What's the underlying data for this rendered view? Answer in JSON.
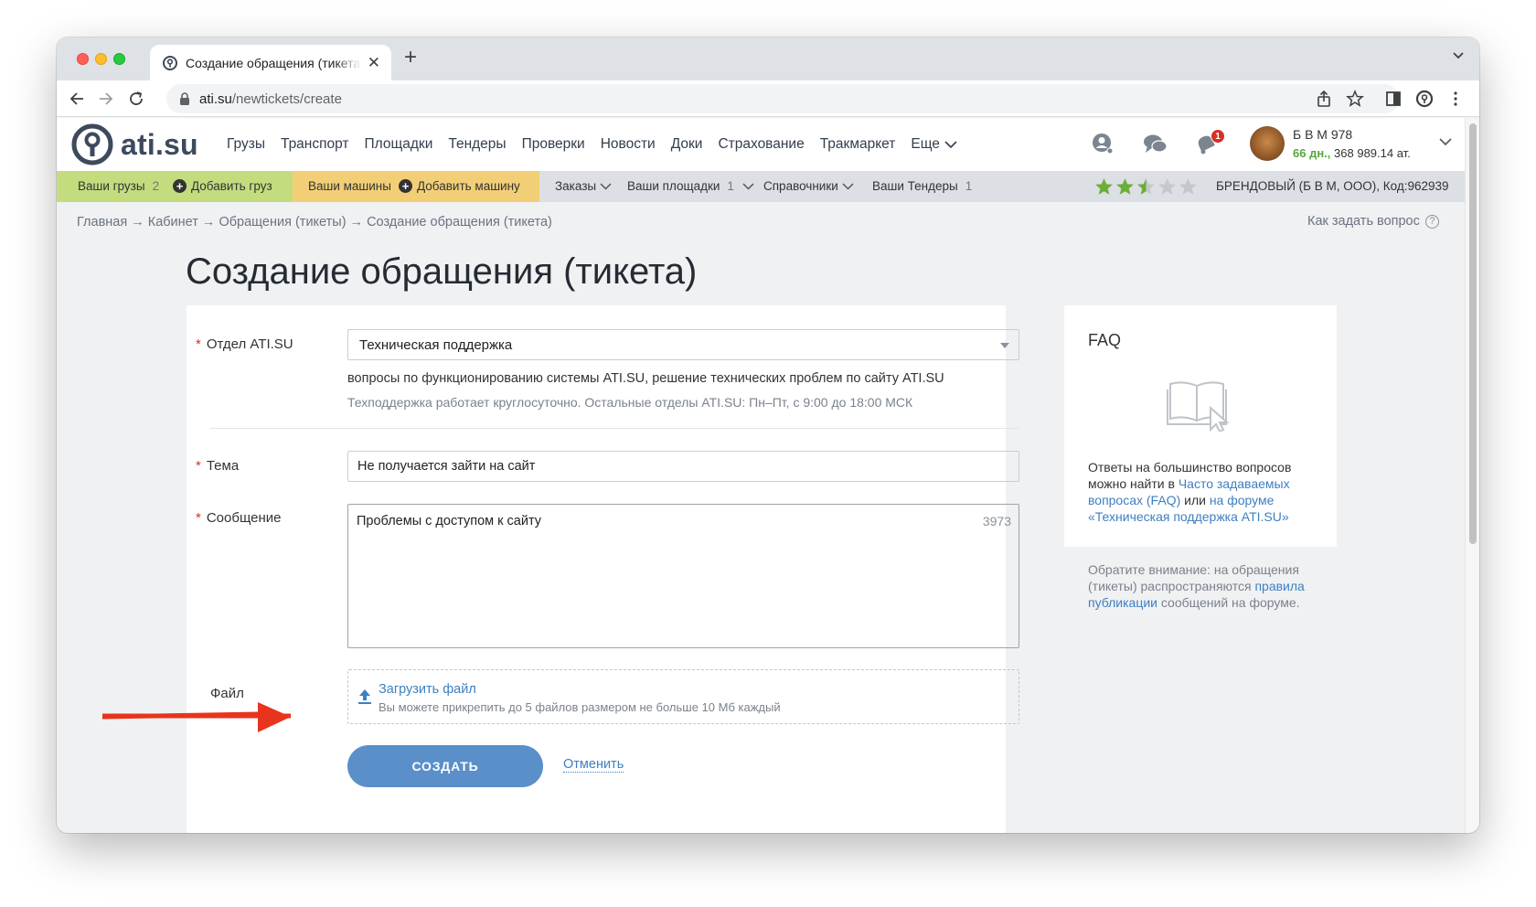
{
  "browser": {
    "tab_title": "Создание обращения (тикета)",
    "url_domain": "ati.su",
    "url_path": "/newtickets/create"
  },
  "header": {
    "logo_text": "ati.su",
    "nav": [
      "Грузы",
      "Транспорт",
      "Площадки",
      "Тендеры",
      "Проверки",
      "Новости",
      "Доки",
      "Страхование",
      "Тракмаркет",
      "Еще"
    ],
    "notification_count": "1",
    "user_name": "Б В М 978",
    "user_days": "66 дн.,",
    "user_balance": "368 989.14 ат."
  },
  "subnav": {
    "your_cargo": "Ваши грузы",
    "your_cargo_count": "2",
    "add_cargo": "Добавить груз",
    "your_vehicles": "Ваши машины",
    "add_vehicle": "Добавить машину",
    "orders": "Заказы",
    "your_sites": "Ваши площадки",
    "your_sites_count": "1",
    "directories": "Справочники",
    "your_tenders": "Ваши Тендеры",
    "your_tenders_count": "1",
    "rating_stars": 2.5,
    "rating_max": 5,
    "firm_info": "БРЕНДОВЫЙ (Б В М, ООО),  Код:962939"
  },
  "breadcrumb": "Главная → Кабинет → Обращения (тикеты) → Создание обращения (тикета)",
  "how_to_ask": "Как задать вопрос",
  "page_title": "Создание обращения (тикета)",
  "form": {
    "department_label": "Отдел ATI.SU",
    "department_value": "Техническая поддержка",
    "department_desc": "вопросы по функционированию системы ATI.SU, решение технических проблем по сайту ATI.SU",
    "department_hours": "Техподдержка работает круглосуточно. Остальные отделы ATI.SU: Пн–Пт, с 9:00 до 18:00 МСК",
    "subject_label": "Тема",
    "subject_value": "Не получается зайти на сайт",
    "message_label": "Сообщение",
    "message_value": "Проблемы с доступом к сайту",
    "message_counter": "3973",
    "file_label": "Файл",
    "upload_link": "Загрузить файл",
    "upload_hint": "Вы можете прикрепить до 5 файлов размером не больше 10 Мб каждый",
    "create_button": "СОЗДАТЬ",
    "cancel_link": "Отменить"
  },
  "faq": {
    "title": "FAQ",
    "text_1": "Ответы на большинство вопросов можно найти в ",
    "link_1": "Часто задаваемых вопросах (FAQ)",
    "text_2": " или ",
    "link_2": "на форуме «Техническая поддержка ATI.SU»"
  },
  "notice": {
    "text_1": "Обратите внимание: на обращения (тикеты) распространяются ",
    "link": "правила публикации",
    "text_2": " сообщений на форуме."
  },
  "colors": {
    "accent": "#5a8fca",
    "link": "#3d7fc1",
    "cargo_bar": "#c3dc7e",
    "vehicles_bar": "#f2cf76",
    "star": "#6aae3a",
    "annotation_arrow": "#e8341c"
  }
}
